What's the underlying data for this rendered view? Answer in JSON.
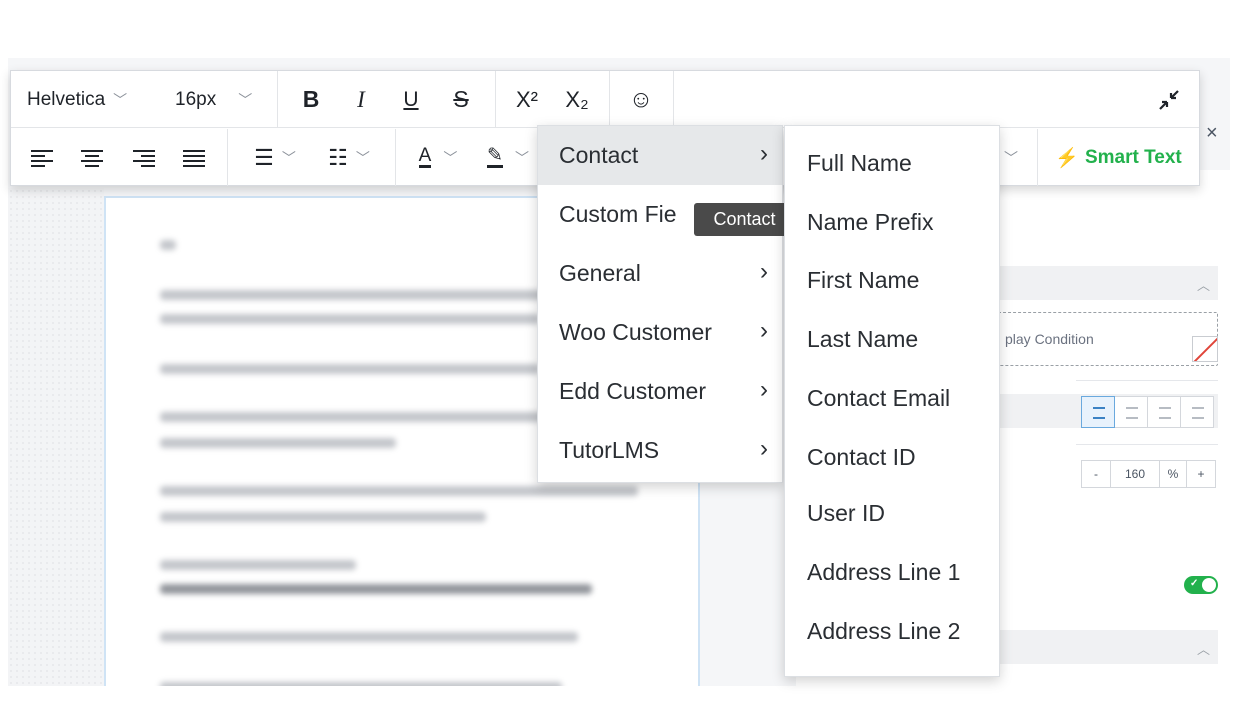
{
  "toolbar": {
    "font_family": "Helvetica",
    "font_size": "16px",
    "bold_glyph": "B",
    "italic_glyph": "I",
    "underline_glyph": "U",
    "strike_glyph": "S",
    "superscript_glyph": "X²",
    "subscript_glyph": "X₂",
    "smart_text_label": "Smart Text"
  },
  "dropdown": {
    "items": [
      {
        "label": "Contact"
      },
      {
        "label": "Custom Fie"
      },
      {
        "label": "General"
      },
      {
        "label": "Woo Customer"
      },
      {
        "label": "Edd Customer"
      },
      {
        "label": "TutorLMS"
      }
    ],
    "tooltip": "Contact"
  },
  "submenu": {
    "items": [
      {
        "label": "Full Name"
      },
      {
        "label": "Name Prefix"
      },
      {
        "label": "First Name"
      },
      {
        "label": "Last Name"
      },
      {
        "label": "Contact Email"
      },
      {
        "label": "Contact ID"
      },
      {
        "label": "User ID"
      },
      {
        "label": "Address Line 1"
      },
      {
        "label": "Address Line 2"
      }
    ]
  },
  "panel": {
    "display_condition_text": "play Condition",
    "line_height": {
      "minus": "-",
      "value": "160",
      "unit": "%",
      "plus": "+"
    },
    "close_glyph": "×"
  },
  "colors": {
    "accent_green": "#22b14c",
    "tooltip_bg": "#4a4a4a",
    "active_item_bg": "#e6e8ea"
  }
}
